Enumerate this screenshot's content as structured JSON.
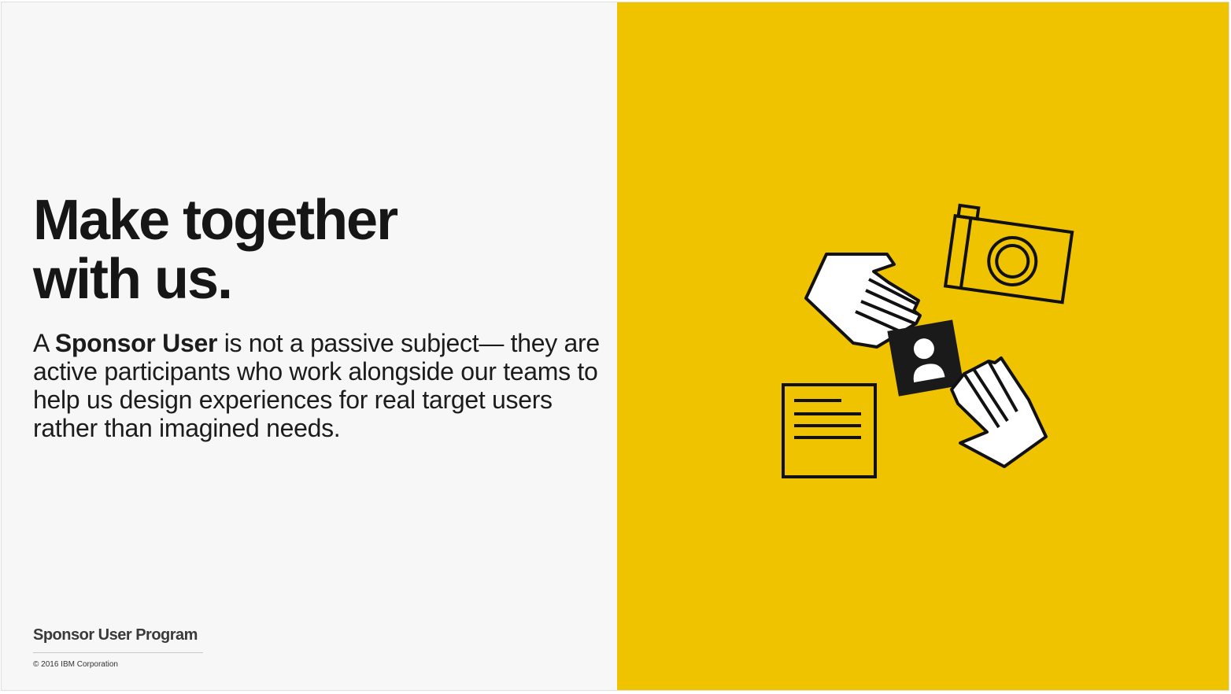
{
  "slide": {
    "headline_line1": "Make together",
    "headline_line2": "with us.",
    "body": {
      "prefix": "A ",
      "bold": "Sponsor User",
      "rest": " is not a passive subject— they are active participants who work alongside our teams to help us design experiences for real target users rather than imagined needs."
    },
    "footer_title": "Sponsor User Program",
    "copyright": "© 2016 IBM Corporation"
  },
  "illustration": {
    "icons": [
      "hand-icon",
      "camera-icon",
      "user-card-icon",
      "note-icon"
    ],
    "colors": {
      "background": "#efc300",
      "stroke": "#111111",
      "fill": "#ffffff",
      "card": "#1a1a1a"
    }
  }
}
